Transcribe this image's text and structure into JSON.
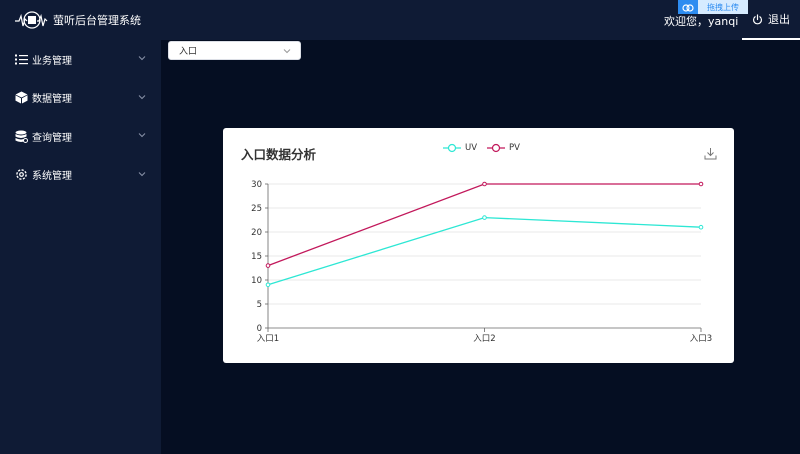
{
  "header": {
    "app_title": "萤听后台管理系统",
    "upload_label": "拖拽上传",
    "welcome_text": "欢迎您，yanqi",
    "logout_label": "退出"
  },
  "sidebar": {
    "items": [
      {
        "label": "业务管理",
        "icon": "list-icon"
      },
      {
        "label": "数据管理",
        "icon": "cube-icon"
      },
      {
        "label": "查询管理",
        "icon": "database-icon"
      },
      {
        "label": "系统管理",
        "icon": "gear-icon"
      }
    ]
  },
  "filter": {
    "selected": "入口"
  },
  "colors": {
    "uv": "#2de7d4",
    "pv": "#c2185b",
    "header_bg": "#0f1b35",
    "main_bg": "#050e22"
  },
  "chart_data": {
    "type": "line",
    "title": "入口数据分析",
    "categories": [
      "入口1",
      "入口2",
      "入口3"
    ],
    "series": [
      {
        "name": "UV",
        "values": [
          9,
          23,
          21
        ]
      },
      {
        "name": "PV",
        "values": [
          13,
          30,
          30
        ]
      }
    ],
    "ylim": [
      0,
      30
    ],
    "yticks": [
      0,
      5,
      10,
      15,
      20,
      25,
      30
    ],
    "grid": true,
    "legend": "top-center"
  }
}
